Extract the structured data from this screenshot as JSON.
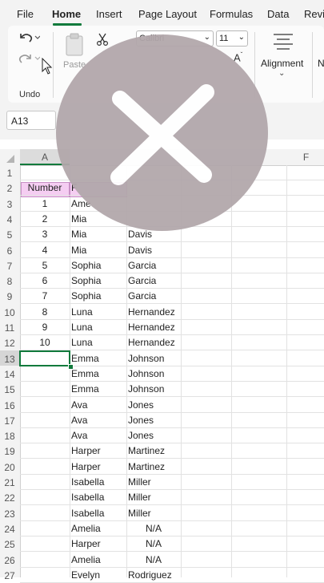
{
  "menu": {
    "tabs": [
      "File",
      "Home",
      "Insert",
      "Page Layout",
      "Formulas",
      "Data",
      "Revi"
    ],
    "active": "Home"
  },
  "ribbon": {
    "undo_label": "Undo",
    "paste_label": "Paste",
    "font_name": "Calibri",
    "font_size": "11",
    "alignment_label": "Alignment",
    "number_group_cut": "N"
  },
  "name_box": "A13",
  "columns": [
    "A",
    "F"
  ],
  "rows": [
    {
      "n": "1",
      "a": "",
      "b": "",
      "c": ""
    },
    {
      "n": "2",
      "a": "Number",
      "b": "F",
      "c": ""
    },
    {
      "n": "3",
      "a": "1",
      "b": "Ame",
      "c": ""
    },
    {
      "n": "4",
      "a": "2",
      "b": "Mia",
      "c": ""
    },
    {
      "n": "5",
      "a": "3",
      "b": "Mia",
      "c": "Davis"
    },
    {
      "n": "6",
      "a": "4",
      "b": "Mia",
      "c": "Davis"
    },
    {
      "n": "7",
      "a": "5",
      "b": "Sophia",
      "c": "Garcia"
    },
    {
      "n": "8",
      "a": "6",
      "b": "Sophia",
      "c": "Garcia"
    },
    {
      "n": "9",
      "a": "7",
      "b": "Sophia",
      "c": "Garcia"
    },
    {
      "n": "10",
      "a": "8",
      "b": "Luna",
      "c": "Hernandez"
    },
    {
      "n": "11",
      "a": "9",
      "b": "Luna",
      "c": "Hernandez"
    },
    {
      "n": "12",
      "a": "10",
      "b": "Luna",
      "c": "Hernandez"
    },
    {
      "n": "13",
      "a": "",
      "b": "Emma",
      "c": "Johnson"
    },
    {
      "n": "14",
      "a": "",
      "b": "Emma",
      "c": "Johnson"
    },
    {
      "n": "15",
      "a": "",
      "b": "Emma",
      "c": "Johnson"
    },
    {
      "n": "16",
      "a": "",
      "b": "Ava",
      "c": "Jones"
    },
    {
      "n": "17",
      "a": "",
      "b": "Ava",
      "c": "Jones"
    },
    {
      "n": "18",
      "a": "",
      "b": "Ava",
      "c": "Jones"
    },
    {
      "n": "19",
      "a": "",
      "b": "Harper",
      "c": "Martinez"
    },
    {
      "n": "20",
      "a": "",
      "b": "Harper",
      "c": "Martinez"
    },
    {
      "n": "21",
      "a": "",
      "b": "Isabella",
      "c": "Miller"
    },
    {
      "n": "22",
      "a": "",
      "b": "Isabella",
      "c": "Miller"
    },
    {
      "n": "23",
      "a": "",
      "b": "Isabella",
      "c": "Miller"
    },
    {
      "n": "24",
      "a": "",
      "b": "Amelia",
      "c": "N/A"
    },
    {
      "n": "25",
      "a": "",
      "b": "Harper",
      "c": "N/A"
    },
    {
      "n": "26",
      "a": "",
      "b": "Amelia",
      "c": "N/A"
    },
    {
      "n": "27",
      "a": "",
      "b": "Evelyn",
      "c": "Rodriguez"
    }
  ],
  "colors": {
    "accent": "#117a3c",
    "header_fill": "#f5cdf2",
    "overlay": "#b2a7ab"
  }
}
